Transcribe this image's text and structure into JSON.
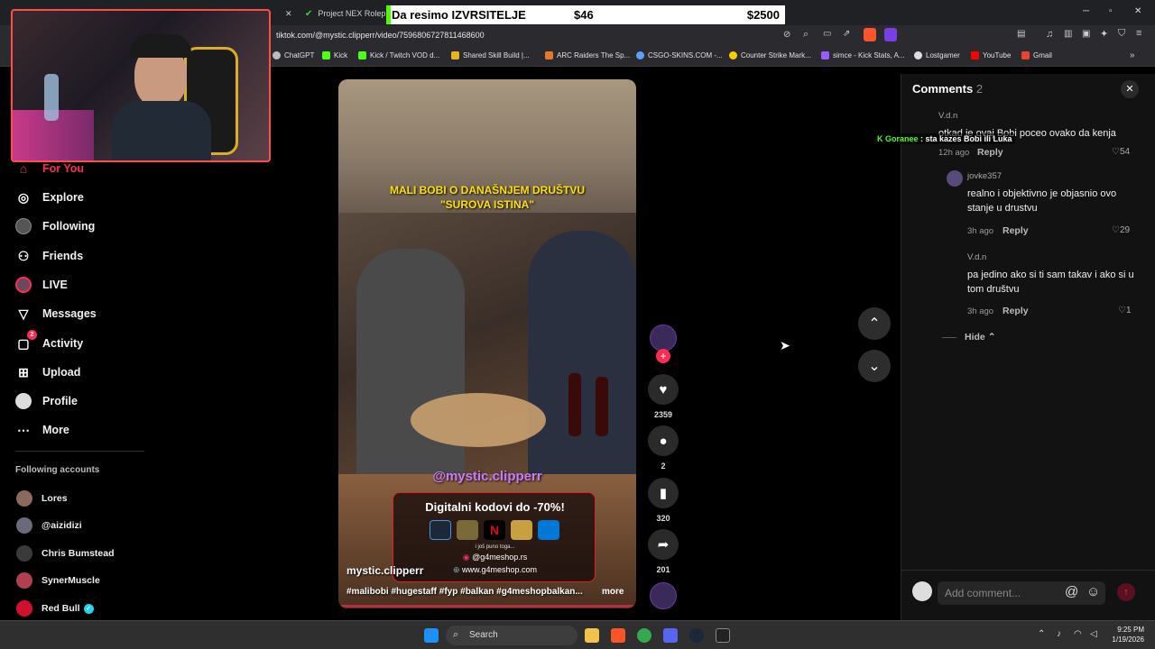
{
  "browser": {
    "tabs": [
      {
        "label": "Project NEX Roleplay"
      }
    ],
    "url": "tiktok.com/@mystic.clipperr/video/7596806727811468600",
    "bookmarks": [
      {
        "label": "ChatGPT",
        "color": "#bbbbbb"
      },
      {
        "label": "Kick",
        "color": "#53fc18"
      },
      {
        "label": "Kick / Twitch VOD d...",
        "color": "#53fc18"
      },
      {
        "label": "Shared Skill Build |...",
        "color": "#e6b422"
      },
      {
        "label": "ARC Raiders The Sp...",
        "color": "#e07a2a"
      },
      {
        "label": "CSGO-SKINS.COM -...",
        "color": "#5aa0ff"
      },
      {
        "label": "Counter Strike Mark...",
        "color": "#ffcc00"
      },
      {
        "label": "simce - Kick Stats, A...",
        "color": "#9b59ff"
      },
      {
        "label": "Lostgamer",
        "color": "#dddddd"
      },
      {
        "label": "YouTube",
        "color": "#ff0000"
      },
      {
        "label": "Gmail",
        "color": "#ea4335"
      }
    ]
  },
  "stream_overlay": {
    "title": "Da resimo IZVRSITELJE",
    "current": "$46",
    "goal": "$2500",
    "chat_user": "Goranee",
    "chat_message": "sta kazes Bobi ili Luka"
  },
  "sidebar": {
    "nav": [
      {
        "label": "For You",
        "icon": "home-icon",
        "active": true
      },
      {
        "label": "Explore",
        "icon": "compass-icon"
      },
      {
        "label": "Following",
        "icon": "following-avatar-icon"
      },
      {
        "label": "Friends",
        "icon": "friends-icon"
      },
      {
        "label": "LIVE",
        "icon": "live-icon"
      },
      {
        "label": "Messages",
        "icon": "messages-icon"
      },
      {
        "label": "Activity",
        "icon": "activity-icon",
        "badge": "2"
      },
      {
        "label": "Upload",
        "icon": "upload-icon"
      },
      {
        "label": "Profile",
        "icon": "profile-icon"
      },
      {
        "label": "More",
        "icon": "more-icon"
      }
    ],
    "following_title": "Following accounts",
    "accounts": [
      {
        "name": "Lores",
        "color": "#8a6a5a"
      },
      {
        "name": "@aizidizi",
        "color": "#6a6a7a"
      },
      {
        "name": "Chris Bumstead",
        "color": "#3a3a3a"
      },
      {
        "name": "SynerMuscle",
        "color": "#b04050"
      },
      {
        "name": "Red Bull",
        "color": "#d0102e",
        "verified": true
      }
    ]
  },
  "video": {
    "caption_line1": "MALI BOBI O DANAŠNJEM DRUŠTVU",
    "caption_line2": "\"SUROVA ISTINA\"",
    "watermark": "@mystic.clipperr",
    "promo_title": "Digitalni kodovi do -70%!",
    "promo_sub": "i još puno toga...",
    "promo_instagram": "@g4meshop.rs",
    "promo_site": "www.g4meshop.com",
    "author": "mystic.clipperr",
    "hashtags": "#malibobi #hugestaff #fyp #balkan #g4meshopbalkan...",
    "more": "more",
    "likes": "2359",
    "comments": "2",
    "saves": "320",
    "shares": "201"
  },
  "comments_panel": {
    "title": "Comments",
    "count": "2",
    "items": [
      {
        "user": "V.d.n",
        "text": "otkad je ovaj Bobi poceo ovako da kenja",
        "time": "12h ago",
        "reply": "Reply",
        "likes": "54"
      },
      {
        "user": "jovke357",
        "text": "realno i objektivno je objasnio ovo stanje u drustvu",
        "time": "3h ago",
        "reply": "Reply",
        "likes": "29"
      },
      {
        "user": "V.d.n",
        "text": "pa jedino ako si ti sam takav i ako si u tom društvu",
        "time": "3h ago",
        "reply": "Reply",
        "likes": "1"
      }
    ],
    "hide_label": "Hide",
    "input_placeholder": "Add comment..."
  },
  "taskbar": {
    "search_placeholder": "Search",
    "time": "9:25 PM",
    "date": "1/19/2026"
  }
}
